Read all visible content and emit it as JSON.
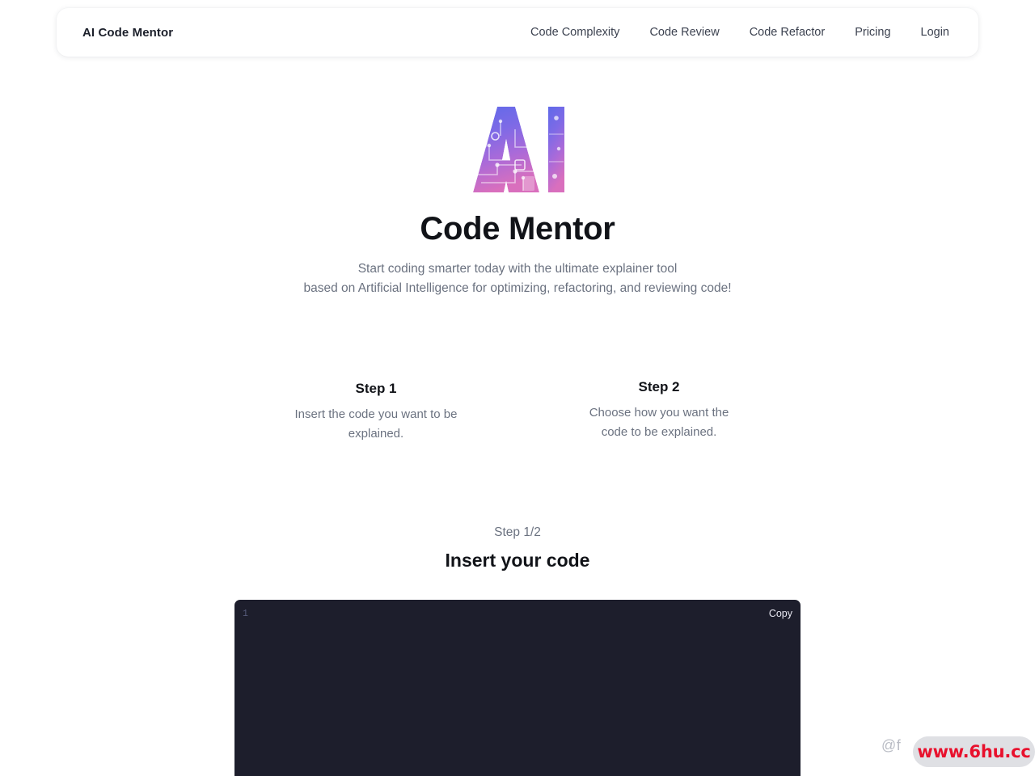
{
  "header": {
    "brand": "AI Code Mentor",
    "nav": [
      {
        "label": "Code Complexity",
        "name": "nav-code-complexity"
      },
      {
        "label": "Code Review",
        "name": "nav-code-review"
      },
      {
        "label": "Code Refactor",
        "name": "nav-code-refactor"
      },
      {
        "label": "Pricing",
        "name": "nav-pricing"
      },
      {
        "label": "Login",
        "name": "nav-login"
      }
    ]
  },
  "hero": {
    "logo_text": "AI",
    "logo_icon": "ai-circuit-logo-icon",
    "logo_gradient_start": "#6a6ce8",
    "logo_gradient_mid": "#9a6ae0",
    "logo_gradient_end": "#d86fc0",
    "title": "Code Mentor",
    "subtitle_line1": "Start coding smarter today with the ultimate explainer tool",
    "subtitle_line2": "based on Artificial Intelligence for optimizing, refactoring, and reviewing code!"
  },
  "steps": [
    {
      "title": "Step 1",
      "desc_line1": "Insert the code you want to be",
      "desc_line2": "explained."
    },
    {
      "title": "Step 2",
      "desc_line1": "Choose how you want the",
      "desc_line2": "code to be explained."
    }
  ],
  "editor_section": {
    "step_counter": "Step 1/2",
    "heading": "Insert your code",
    "line_number": "1",
    "code_value": "",
    "code_placeholder": "",
    "copy_label": "Copy",
    "editor_background": "#1d1e2c"
  },
  "watermark": {
    "author": "@f",
    "url": "www.6hu.cc",
    "url_color": "#e8112d",
    "pill_color": "#dfe0e4"
  }
}
